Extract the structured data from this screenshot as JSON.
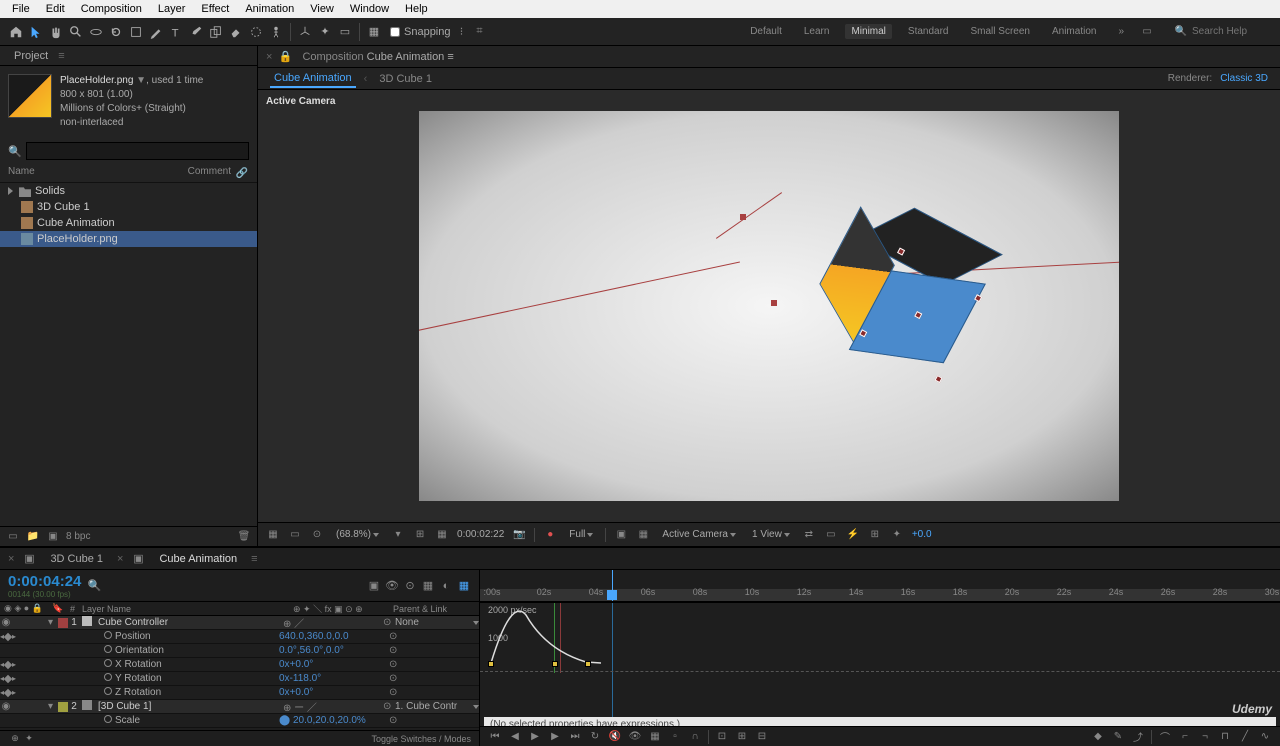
{
  "menu": [
    "File",
    "Edit",
    "Composition",
    "Layer",
    "Effect",
    "Animation",
    "View",
    "Window",
    "Help"
  ],
  "toolbar": {
    "snapping_label": "Snapping",
    "workspaces": [
      "Minimal",
      "Standard",
      "Small Screen",
      "Animation"
    ],
    "search_placeholder": "Search Help"
  },
  "project_panel": {
    "title": "Project",
    "asset": {
      "name": "PlaceHolder.png",
      "used": ", used 1 time",
      "dims": "800 x 801 (1.00)",
      "colors": "Millions of Colors+ (Straight)",
      "interlace": "non-interlaced"
    },
    "cols": {
      "name": "Name",
      "comment": "Comment"
    },
    "items": [
      "Solids",
      "3D Cube 1",
      "Cube Animation",
      "PlaceHolder.png"
    ],
    "footer_bpc": "8 bpc"
  },
  "comp_panel": {
    "tab_prefix": "Composition",
    "tab_name": "Cube Animation",
    "crumbs": [
      "Cube Animation",
      "3D Cube 1"
    ],
    "renderer_label": "Renderer:",
    "renderer_value": "Classic 3D",
    "active_camera": "Active Camera",
    "viewer": {
      "zoom": "(68.8%)",
      "time": "0:00:02:22",
      "res": "Full",
      "view_label": "Active Camera",
      "views": "1 View",
      "exposure": "+0.0"
    }
  },
  "timeline": {
    "tabs": [
      "3D Cube 1",
      "Cube Animation"
    ],
    "timecode": "0:00:04:24",
    "timecode_sub": "00144 (30.00 fps)",
    "cols": {
      "layer_name": "Layer Name",
      "parent": "Parent & Link"
    },
    "ticks": [
      ":00s",
      "02s",
      "04s",
      "06s",
      "08s",
      "10s",
      "12s",
      "14s",
      "16s",
      "18s",
      "20s",
      "22s",
      "24s",
      "26s",
      "28s",
      "30s"
    ],
    "layers": [
      {
        "num": "1",
        "name": "Cube Controller",
        "parent": "None",
        "color": "#a04040",
        "props": [
          {
            "name": "Position",
            "val": "640.0,360.0,0.0"
          },
          {
            "name": "Orientation",
            "val": "0.0°,56.0°,0.0°"
          },
          {
            "name": "X Rotation",
            "val": "0x+0.0°"
          },
          {
            "name": "Y Rotation",
            "val": "0x-118.0°"
          },
          {
            "name": "Z Rotation",
            "val": "0x+0.0°"
          }
        ]
      },
      {
        "num": "2",
        "name": "[3D Cube 1]",
        "parent": "1. Cube Contr",
        "color": "#a0a040",
        "props": [
          {
            "name": "Scale",
            "val": "20.0,20.0,20.0%"
          }
        ]
      }
    ],
    "graph_labels": {
      "top": "2000 px/sec",
      "mid": "1000"
    },
    "expr_msg": "(No selected properties have expressions.)",
    "footer_toggle": "Toggle Switches / Modes"
  },
  "udemy": "Udemy"
}
